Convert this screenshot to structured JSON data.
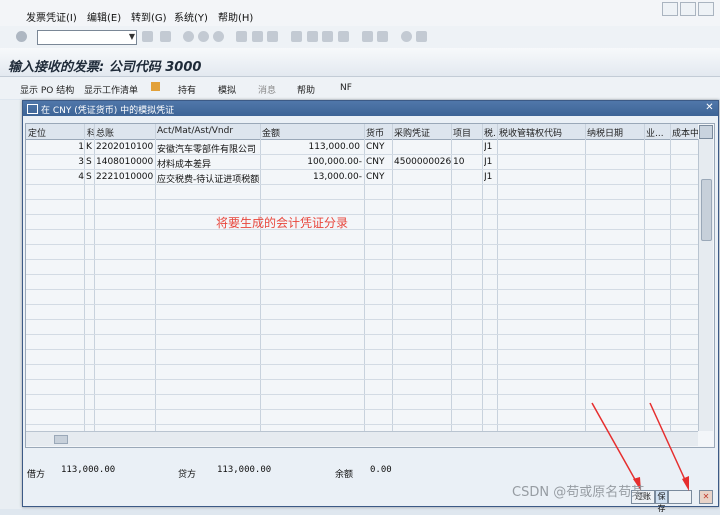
{
  "menubar": {
    "items": [
      "发票凭证(I)",
      "编辑(E)",
      "转到(G)",
      "系统(Y)",
      "帮助(H)"
    ]
  },
  "toolbar": {
    "command_field_value": ""
  },
  "page": {
    "title": "输入接收的发票: 公司代码 3000"
  },
  "app_toolbar": {
    "items": [
      "显示 PO 结构",
      "显示工作清单",
      "持有",
      "模拟",
      "消息",
      "帮助",
      "NF"
    ]
  },
  "dialog": {
    "title": "在 CNY (凭证货币) 中的模拟凭证",
    "columns": [
      "定位",
      "科",
      "总账",
      "Act/Mat/Ast/Vndr",
      "金额",
      "货币",
      "采购凭证",
      "项目",
      "税...",
      "税收管辖权代码",
      "纳税日期",
      "业...",
      "成本中"
    ],
    "rows": [
      {
        "pos": "1",
        "key": "K",
        "gl": "2202010100",
        "vendor": "安徽汽车零部件有限公司 /...",
        "amount": "113,000.00",
        "currency": "CNY",
        "po": "",
        "item": "",
        "tax": "J1"
      },
      {
        "pos": "3",
        "key": "S",
        "gl": "1408010000",
        "vendor": "材料成本差异",
        "amount": "100,000.00-",
        "currency": "CNY",
        "po": "4500000026",
        "item": "10",
        "tax": "J1"
      },
      {
        "pos": "4",
        "key": "S",
        "gl": "2221010000",
        "vendor": "应交税费-待认证进项税额",
        "amount": "13,000.00-",
        "currency": "CNY",
        "po": "",
        "item": "",
        "tax": "J1"
      }
    ],
    "annotation": "将要生成的会计凭证分录",
    "totals": {
      "debit_label": "借方",
      "debit_value": "113,000.00",
      "credit_label": "贷方",
      "credit_value": "113,000.00",
      "balance_label": "余额",
      "balance_value": "0.00"
    },
    "buttons": {
      "post": "过账",
      "save": "保存",
      "close": "✕"
    }
  },
  "watermark": "CSDN @苟或原名苟某",
  "colors": {
    "annotation": "#e8473d",
    "titlebar": "#3d6496"
  }
}
